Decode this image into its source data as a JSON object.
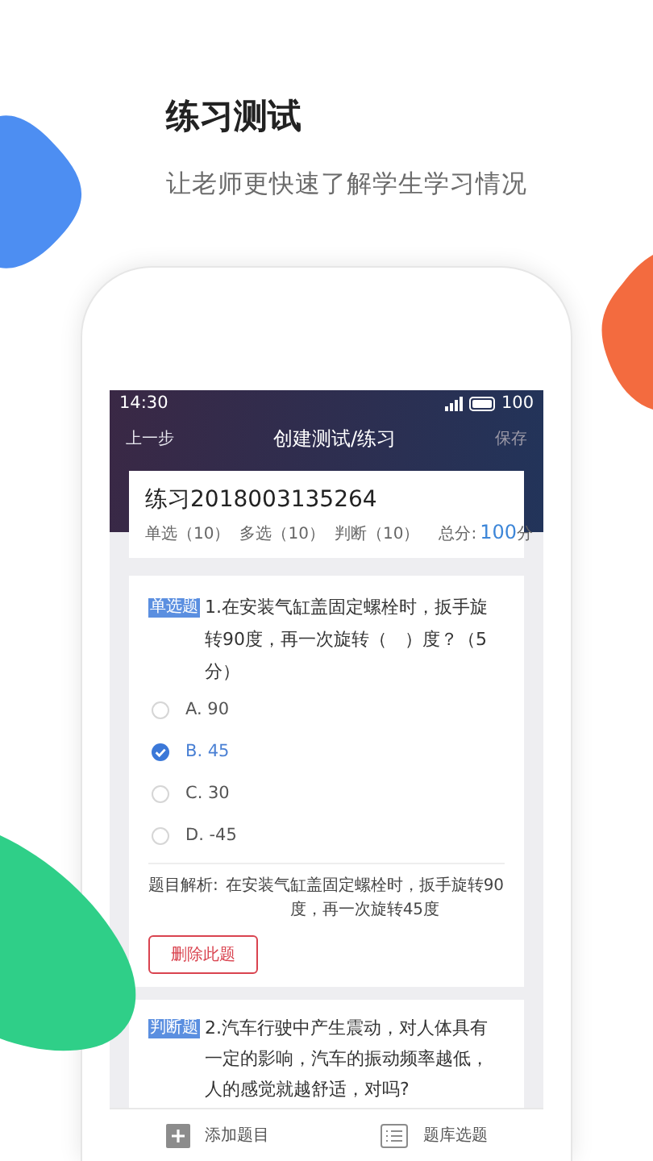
{
  "heading": {
    "title": "练习测试",
    "subtitle": "让老师更快速了解学生学习情况"
  },
  "status_bar": {
    "time": "14:30",
    "battery": "100"
  },
  "nav": {
    "back": "上一步",
    "title": "创建测试/练习",
    "save": "保存"
  },
  "summary": {
    "name": "练习2018003135264",
    "counts": [
      "单选（10）",
      "多选（10）",
      "判断（10）"
    ],
    "total_label": "总分:",
    "total_value": "100",
    "total_unit": "分"
  },
  "questions": [
    {
      "kind": "choice",
      "badge": "单选题",
      "text": "1.在安装气缸盖固定螺栓时，扳手旋转90度，再一次旋转（　）度？（5分）",
      "options": [
        {
          "label": "A. 90",
          "selected": false
        },
        {
          "label": "B. 45",
          "selected": true
        },
        {
          "label": "C. 30",
          "selected": false
        },
        {
          "label": "D. -45",
          "selected": false
        }
      ],
      "analysis_label": "题目解析:",
      "analysis": "在安装气缸盖固定螺栓时，扳手旋转90度，再一次旋转45度",
      "delete": "删除此题"
    },
    {
      "kind": "judge",
      "badge": "判断题",
      "text": "2.汽车行驶中产生震动，对人体具有一定的影响，汽车的振动频率越低，人的感觉就越舒适，对吗?"
    }
  ],
  "bottom_bar": [
    {
      "label": "添加题目"
    },
    {
      "label": "题库选题"
    }
  ]
}
